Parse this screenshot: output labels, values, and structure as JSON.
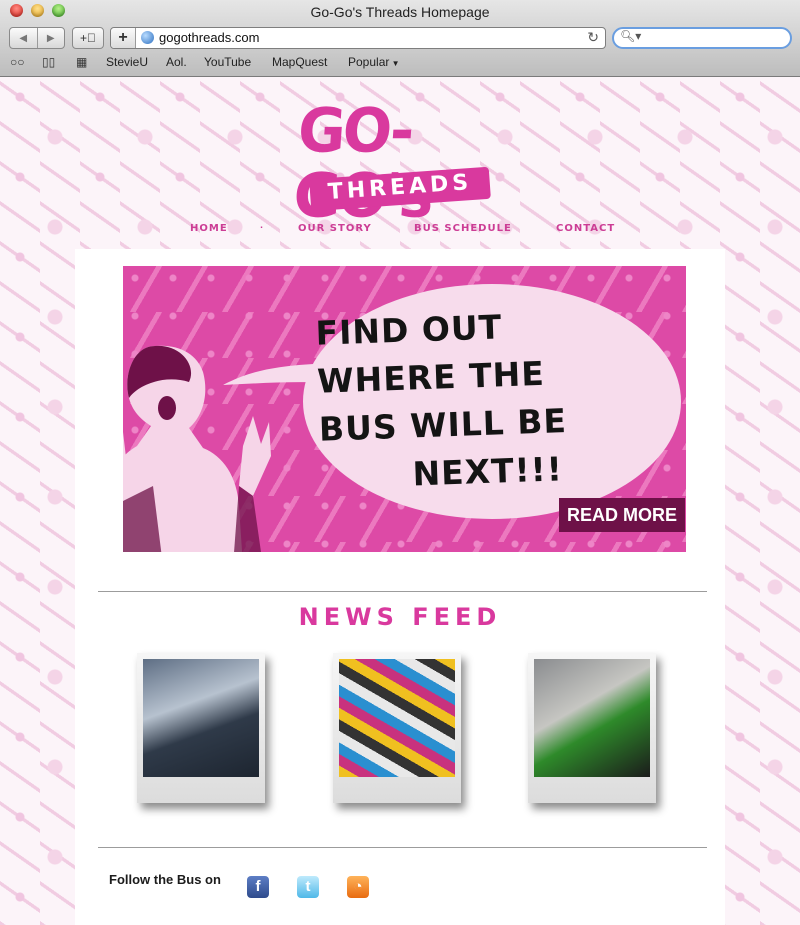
{
  "window": {
    "title": "Go-Go's Threads Homepage"
  },
  "toolbar": {
    "url": "gogothreads.com"
  },
  "bookmarks": [
    "StevieU",
    "Aol.",
    "YouTube",
    "MapQuest",
    "Popular"
  ],
  "logo": {
    "main": "GO-GO's",
    "sub": "THREADS"
  },
  "nav": [
    "HOME",
    "OUR STORY",
    "BUS SCHEDULE",
    "CONTACT"
  ],
  "hero": {
    "bubble_lines": [
      "FIND OUT",
      "WHERE THE",
      "BUS WILL BE",
      "NEXT!!!"
    ],
    "button": "READ MORE"
  },
  "news": {
    "title": "NEWS FEED"
  },
  "follow": {
    "label": "Follow the Bus on"
  },
  "colors": {
    "brand_pink": "#d9399e",
    "dark_plum": "#6e1148",
    "link_blue": "#6a9ee0"
  }
}
